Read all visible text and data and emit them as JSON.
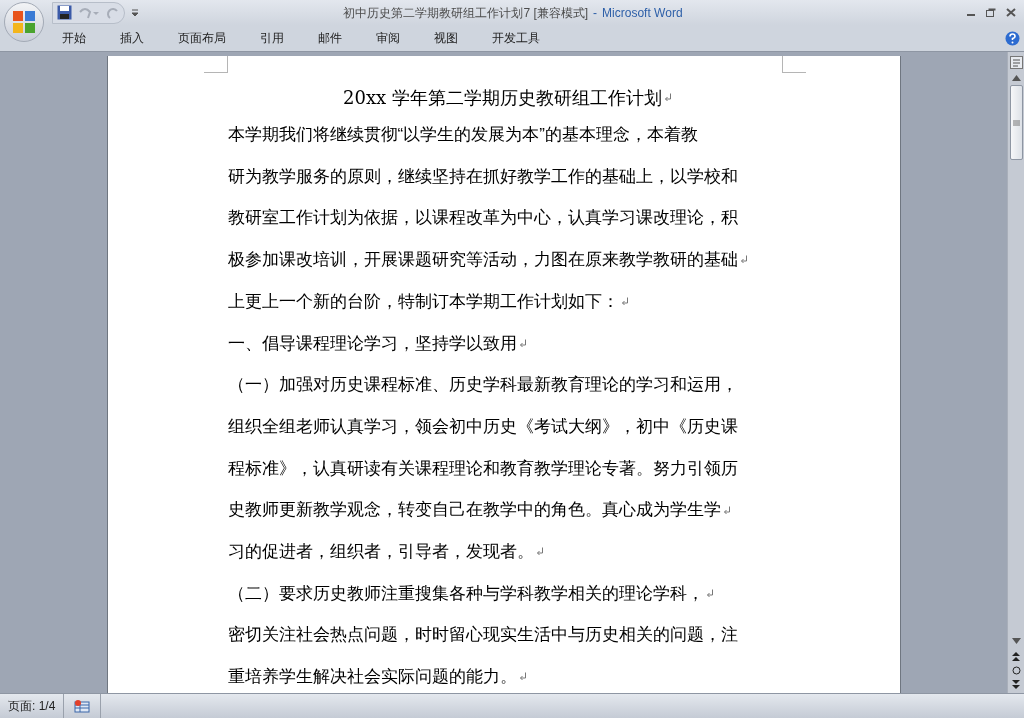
{
  "window": {
    "doc_title": "初中历史第二学期教研组工作计划7 [兼容模式]",
    "separator": "-",
    "app_name": "Microsoft Word"
  },
  "ribbon_tabs": [
    {
      "label": "开始",
      "selected": false
    },
    {
      "label": "插入",
      "selected": false
    },
    {
      "label": "页面布局",
      "selected": false
    },
    {
      "label": "引用",
      "selected": false
    },
    {
      "label": "邮件",
      "selected": false
    },
    {
      "label": "审阅",
      "selected": false
    },
    {
      "label": "视图",
      "selected": false
    },
    {
      "label": "开发工具",
      "selected": false
    }
  ],
  "document": {
    "title": {
      "text": "20xx 学年第二学期历史教研组工作计划",
      "paragraph_mark": true
    },
    "lines": [
      {
        "text": "本学期我们将继续贯彻“以学生的发展为本”的基本理念，本着教",
        "paragraph_mark": false
      },
      {
        "text": "研为教学服务的原则，继续坚持在抓好教学工作的基础上，以学校和",
        "paragraph_mark": false
      },
      {
        "text": "教研室工作计划为依据，以课程改革为中心，认真学习课改理论，积",
        "paragraph_mark": false
      },
      {
        "text": "极参加课改培训，开展课题研究等活动，力图在原来教学教研的基础",
        "paragraph_mark": true
      },
      {
        "text": "上更上一个新的台阶，特制订本学期工作计划如下：",
        "paragraph_mark": true
      },
      {
        "text": "一、倡导课程理论学习，坚持学以致用",
        "paragraph_mark": true
      },
      {
        "text": "（一）加强对历史课程标准、历史学科最新教育理论的学习和运用，",
        "paragraph_mark": false
      },
      {
        "text": "组织全组老师认真学习，领会初中历史《考试大纲》，初中《历史课",
        "paragraph_mark": false
      },
      {
        "text": "程标准》，认真研读有关课程理论和教育教学理论专著。努力引领历",
        "paragraph_mark": false
      },
      {
        "text": "史教师更新教学观念，转变自己在教学中的角色。真心成为学生学",
        "paragraph_mark": true
      },
      {
        "text": "习的促进者，组织者，引导者，发现者。",
        "paragraph_mark": true
      },
      {
        "text": "（二）要求历史教师注重搜集各种与学科教学相关的理论学科，",
        "paragraph_mark": true
      },
      {
        "text": "密切关注社会热点问题，时时留心现实生活中与历史相关的问题，注",
        "paragraph_mark": false
      },
      {
        "text": "重培养学生解决社会实际问题的能力。",
        "paragraph_mark": true
      }
    ]
  },
  "status_bar": {
    "page": "页面: 1/4"
  }
}
